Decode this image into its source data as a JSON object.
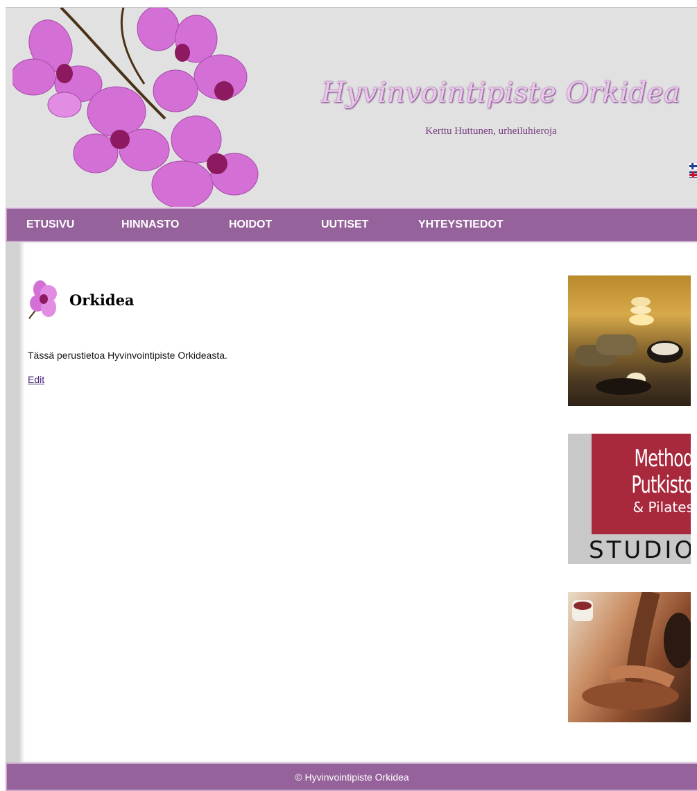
{
  "header": {
    "site_title": "Hyvinvointipiste Orkidea",
    "subtitle": "Kerttu Huttunen, urheiluhieroja",
    "languages": [
      {
        "label": "Suomi",
        "icon": "finnish-flag-icon"
      },
      {
        "label": "English",
        "icon": "british-flag-icon"
      }
    ]
  },
  "nav": {
    "items": [
      {
        "label": "ETUSIVU"
      },
      {
        "label": "HINNASTO"
      },
      {
        "label": "HOIDOT"
      },
      {
        "label": "UUTISET"
      },
      {
        "label": "YHTEYSTIEDOT"
      }
    ]
  },
  "main": {
    "title": "Orkidea",
    "intro": "Tässä perustietoa Hyvinvointipiste Orkideasta.",
    "edit_label": "Edit"
  },
  "sidebar": {
    "method_logo": {
      "line1": "Method",
      "line2": "Putkisto",
      "line3": "& Pilates",
      "line4": "STUDIO"
    }
  },
  "footer": {
    "copyright": "© Hyvinvointipiste Orkidea"
  },
  "colors": {
    "nav_bg": "#95629b",
    "header_bg": "#e1e1e1",
    "title_color": "#e9c8ea",
    "subtitle_color": "#7a3e82"
  }
}
